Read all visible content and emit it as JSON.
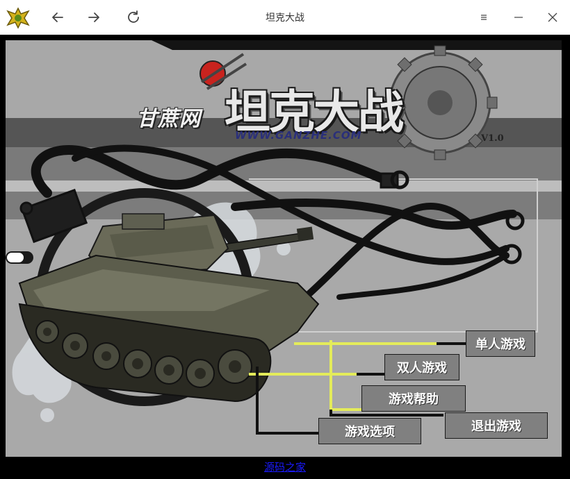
{
  "window": {
    "title": "坦克大战",
    "nav": {
      "back_icon": "arrow-left-icon",
      "forward_icon": "arrow-right-icon",
      "refresh_icon": "refresh-icon"
    },
    "controls": {
      "menu_icon": "menu-icon",
      "minimize_icon": "minimize-icon",
      "close_icon": "close-icon"
    }
  },
  "logo": {
    "site_name": "甘蔗网",
    "game_title": "坦克大战",
    "url": "WWW.GANZHE.COM",
    "version": "V1.0"
  },
  "menu": {
    "single_player": "单人游戏",
    "two_player": "双人游戏",
    "help": "游戏帮助",
    "exit": "退出游戏",
    "options": "游戏选项"
  },
  "footer": {
    "link": "源码之家"
  },
  "colors": {
    "background": "#a8a8a8",
    "band_dark": "#555555",
    "band_light": "#bdbdbd",
    "accent_line": "#e4ec5a",
    "button_bg": "#808080"
  }
}
